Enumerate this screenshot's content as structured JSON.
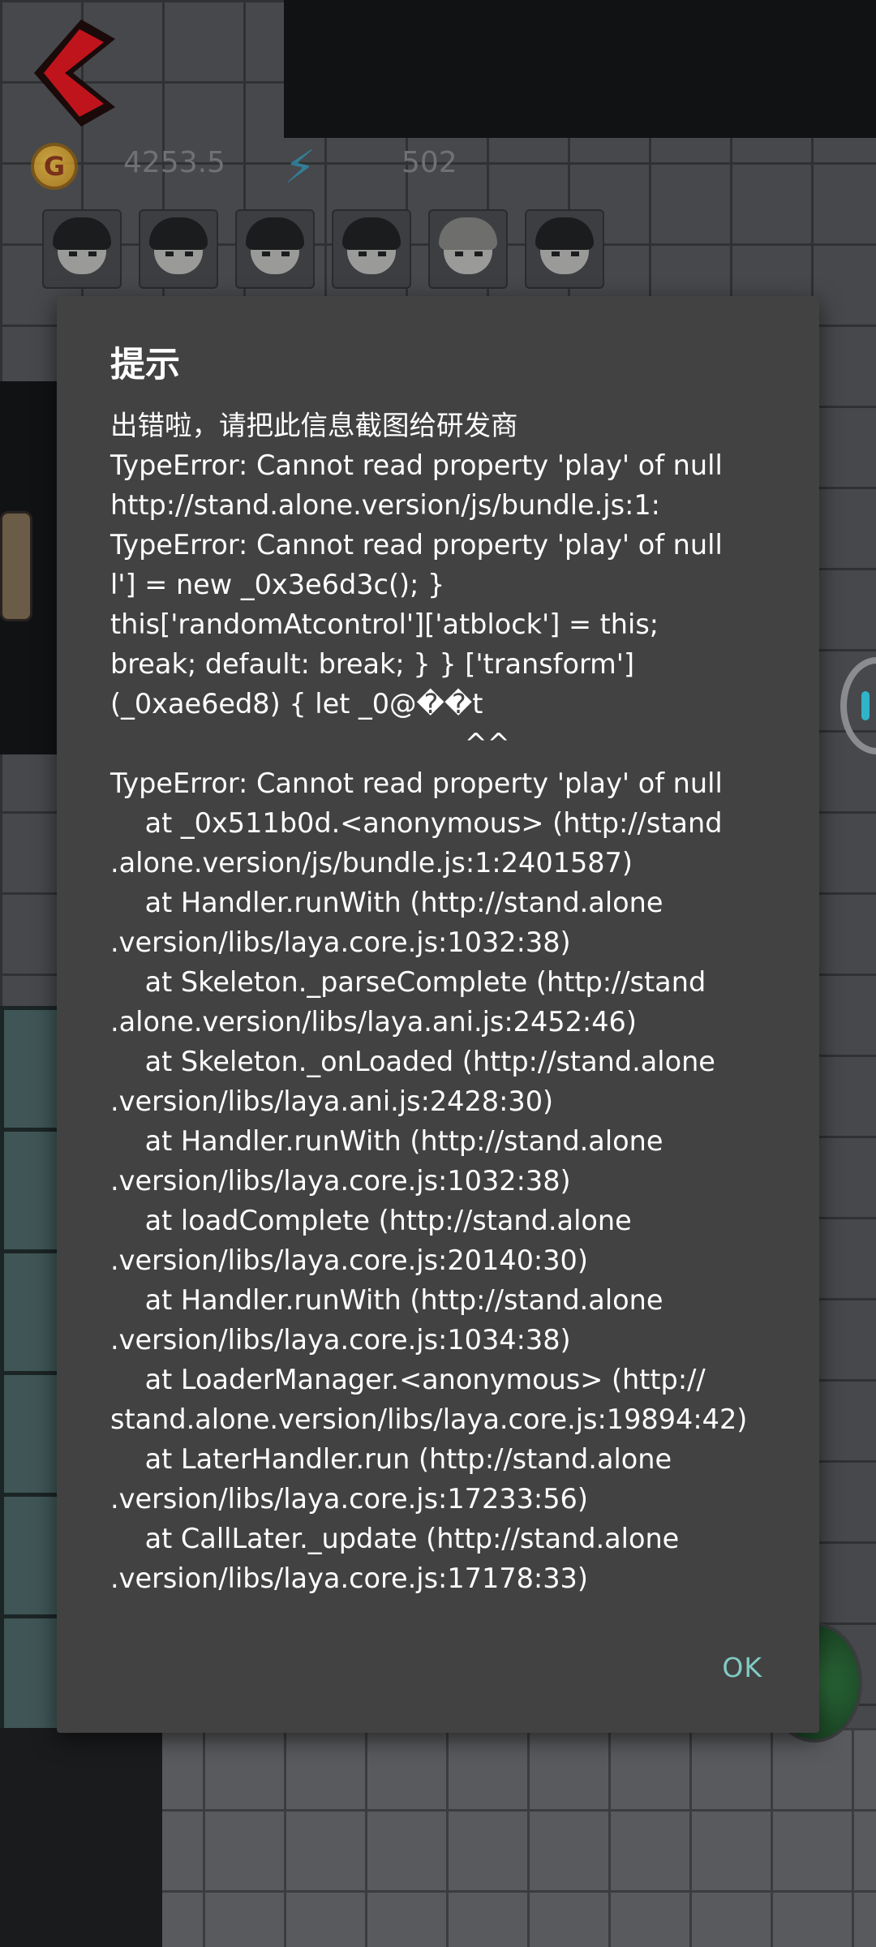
{
  "hud": {
    "coins_value": "4253.5",
    "energy_value": "502",
    "coin_icon_letter": "G"
  },
  "avatars": [
    {
      "icon": "character-avatar-1"
    },
    {
      "icon": "character-avatar-2"
    },
    {
      "icon": "character-avatar-3"
    },
    {
      "icon": "character-avatar-4"
    },
    {
      "icon": "character-avatar-5"
    },
    {
      "icon": "character-avatar-6"
    }
  ],
  "dialog": {
    "title": "提示",
    "message_lines": [
      "出错啦，请把此信息截图给研发商",
      "TypeError: Cannot read property 'play' of null",
      "http://stand.alone.version/js/bundle.js:1:",
      "TypeError: Cannot read property 'play' of null",
      "l'] = new _0x3e6d3c(); }",
      "this['randomAtcontrol']['atblock'] = this;",
      "break; default: break; } } ['transform']",
      "(_0xae6ed8) { let _0@��t",
      "                                         ^^",
      "TypeError: Cannot read property 'play' of null",
      "    at _0x511b0d.<anonymous> (http://stand",
      ".alone.version/js/bundle.js:1:2401587)",
      "    at Handler.runWith (http://stand.alone",
      ".version/libs/laya.core.js:1032:38)",
      "    at Skeleton._parseComplete (http://stand",
      ".alone.version/libs/laya.ani.js:2452:46)",
      "    at Skeleton._onLoaded (http://stand.alone",
      ".version/libs/laya.ani.js:2428:30)",
      "    at Handler.runWith (http://stand.alone",
      ".version/libs/laya.core.js:1032:38)",
      "    at loadComplete (http://stand.alone",
      ".version/libs/laya.core.js:20140:30)",
      "    at Handler.runWith (http://stand.alone",
      ".version/libs/laya.core.js:1034:38)",
      "    at LoaderManager.<anonymous> (http://",
      "stand.alone.version/libs/laya.core.js:19894:42)",
      "    at LaterHandler.run (http://stand.alone",
      ".version/libs/laya.core.js:17233:56)",
      "    at CallLater._update (http://stand.alone",
      ".version/libs/laya.core.js:17178:33)"
    ],
    "ok_label": "OK"
  },
  "colors": {
    "dialog_bg": "#424242",
    "ok_accent": "#80cbc4",
    "back_arrow_red": "#c0141c"
  }
}
